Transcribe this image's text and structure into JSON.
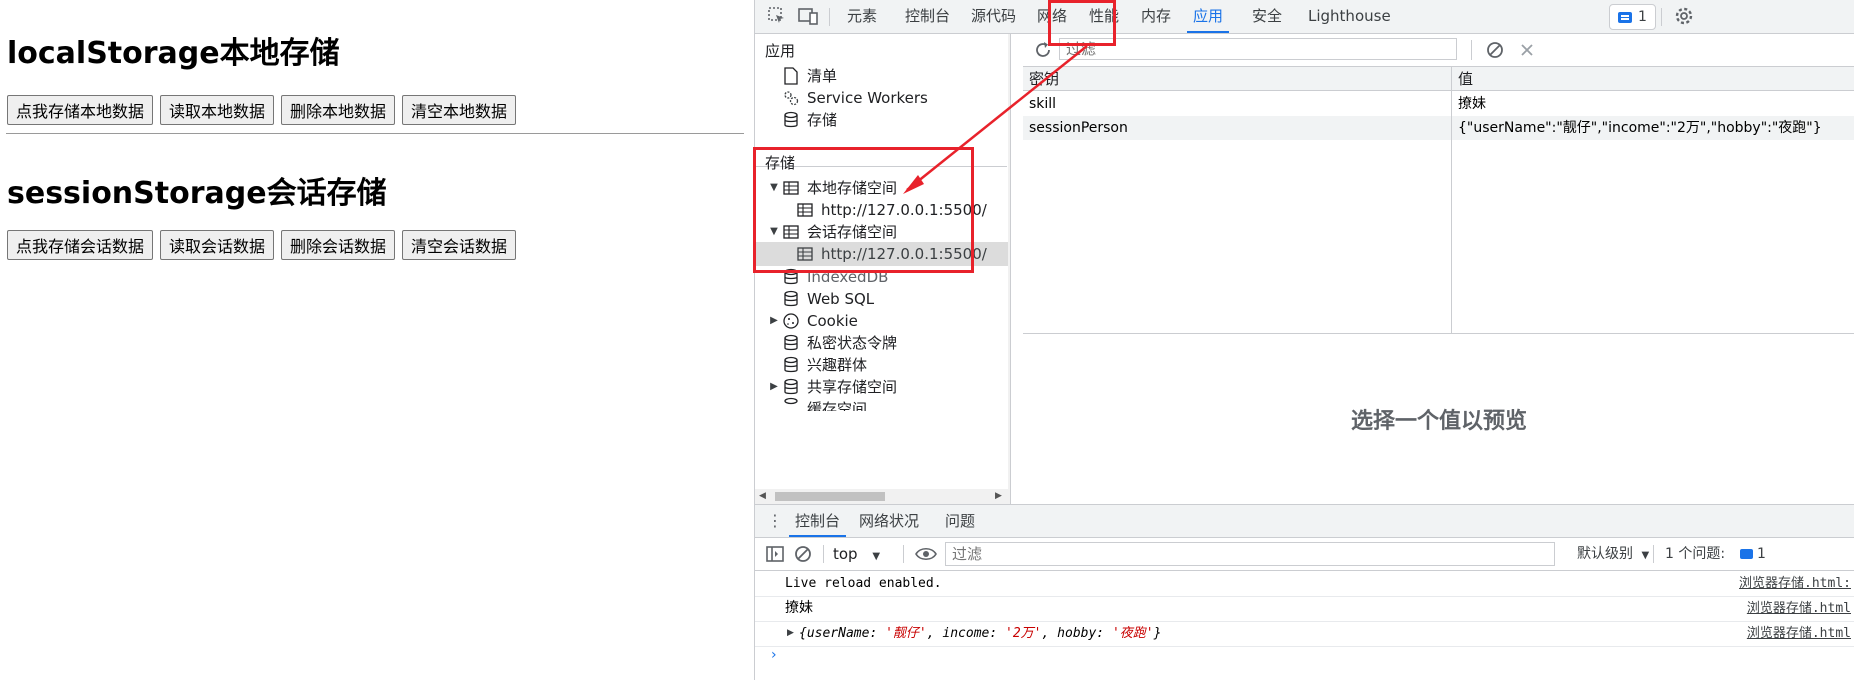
{
  "page": {
    "local_title": "localStorage本地存储",
    "local_buttons": [
      "点我存储本地数据",
      "读取本地数据",
      "删除本地数据",
      "清空本地数据"
    ],
    "session_title": "sessionStorage会话存储",
    "session_buttons": [
      "点我存储会话数据",
      "读取会话数据",
      "删除会话数据",
      "清空会话数据"
    ]
  },
  "devtools": {
    "tabs": [
      "元素",
      "控制台",
      "源代码",
      "网络",
      "性能",
      "内存",
      "应用",
      "安全",
      "Lighthouse"
    ],
    "active_tab": "应用",
    "issues_count": "1",
    "sidebar": {
      "app_header": "应用",
      "app_items": [
        "清单",
        "Service Workers",
        "存储"
      ],
      "storage_header": "存储",
      "local_storage": "本地存储空间",
      "local_origin": "http://127.0.0.1:5500/",
      "session_storage": "会话存储空间",
      "session_origin": "http://127.0.0.1:5500/",
      "other_items": [
        "IndexedDB",
        "Web SQL",
        "Cookie",
        "私密状态令牌",
        "兴趣群体",
        "共享存储空间",
        "缓存空间"
      ]
    },
    "main": {
      "filter_placeholder": "过滤",
      "col_key": "密钥",
      "col_value": "值",
      "rows": [
        {
          "key": "skill",
          "value": "撩妹"
        },
        {
          "key": "sessionPerson",
          "value": "{\"userName\":\"靓仔\",\"income\":\"2万\",\"hobby\":\"夜跑\"}"
        }
      ],
      "preview_text": "选择一个值以预览"
    },
    "drawer": {
      "tabs": [
        "控制台",
        "网络状况",
        "问题"
      ],
      "context": "top",
      "filter_placeholder": "过滤",
      "level": "默认级别",
      "issues": "1 个问题:",
      "issues_count": "1",
      "messages": [
        {
          "text": "Live reload enabled.",
          "source": "浏览器存储.html:"
        },
        {
          "text": "撩妹",
          "source": "浏览器存储.html"
        },
        {
          "source": "浏览器存储.html"
        }
      ],
      "obj_prefix": "{userName: ",
      "obj_v1": "'靓仔'",
      "obj_mid1": ", income: ",
      "obj_v2": "'2万'",
      "obj_mid2": ", hobby: ",
      "obj_v3": "'夜跑'",
      "obj_suffix": "}"
    }
  },
  "colors": {
    "accent": "#1a73e8",
    "annotation": "#e8222b",
    "string_value": "#c80000"
  }
}
